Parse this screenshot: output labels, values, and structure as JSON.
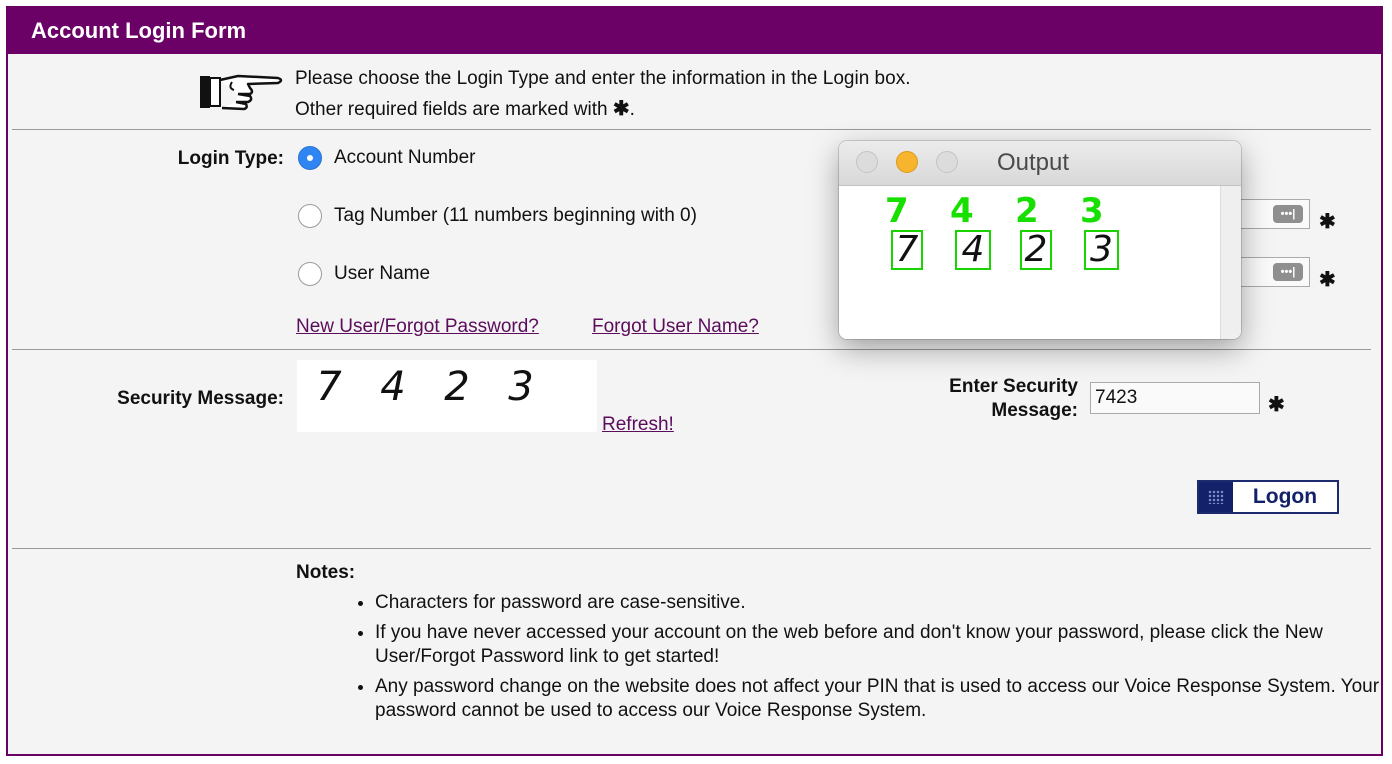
{
  "form": {
    "title": "Account Login Form",
    "intro_line1": "Please choose the Login Type and enter the information in the Login box.",
    "intro_line2": "Other required fields are marked with",
    "intro_line2_end": "."
  },
  "login_type": {
    "label": "Login Type:",
    "options": [
      {
        "label": "Account Number",
        "selected": true
      },
      {
        "label": "Tag Number (11 numbers beginning with 0)",
        "selected": false
      },
      {
        "label": "User Name",
        "selected": false
      }
    ],
    "link_new_user": "New User/Forgot Password? ",
    "link_forgot_user": "Forgot User Name?"
  },
  "security": {
    "label": "Security Message:",
    "captcha_chars": [
      "7",
      "4",
      "2",
      "3"
    ],
    "refresh_label": "Refresh!",
    "enter_label_line1": "Enter Security",
    "enter_label_line2": "Message:",
    "entered_value": "7423",
    "required_mark": "✱"
  },
  "logon_button": "Logon",
  "notes": {
    "title": "Notes:",
    "items": [
      "Characters for password are case-sensitive.",
      "If you have never accessed your account on the web before and don't know your password, please click the New User/Forgot Password link to get started!",
      "Any password change on the website does not affect your PIN that is used to access our Voice Response System. Your password cannot be used to access our Voice Response System."
    ]
  },
  "output_window": {
    "title": "Output",
    "detected": [
      "7",
      "4",
      "2",
      "3"
    ]
  },
  "colors": {
    "header_purple": "#6b0066",
    "link_purple": "#5b0c5b",
    "logon_navy": "#13216a",
    "detect_green": "#17e000"
  }
}
